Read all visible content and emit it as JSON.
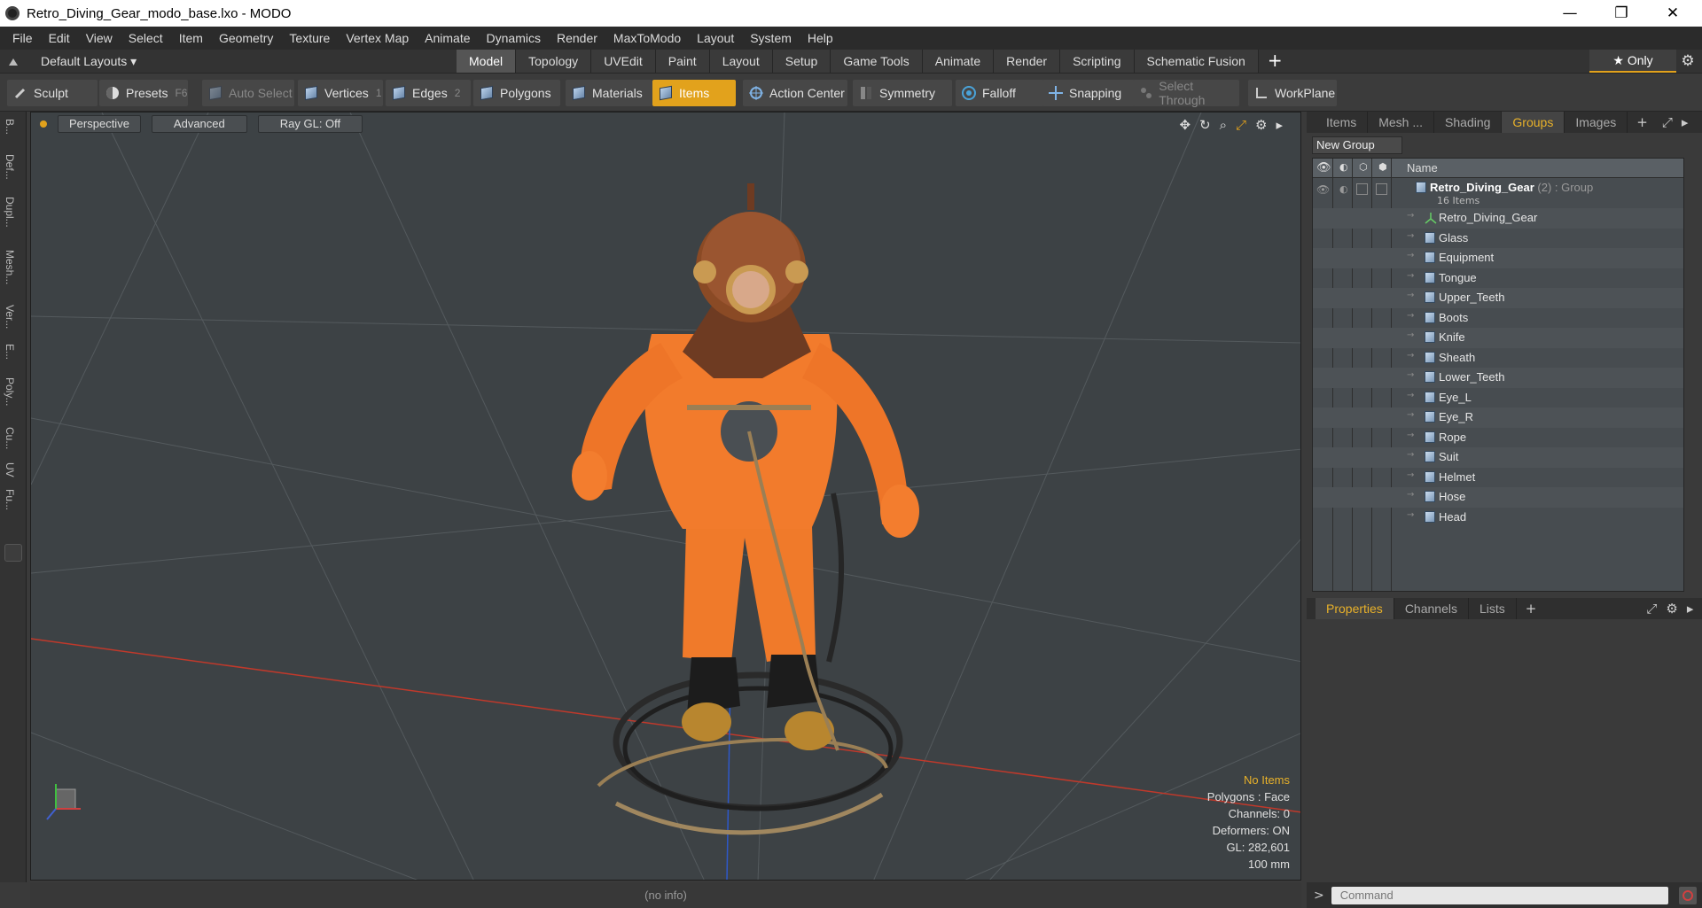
{
  "window": {
    "title": "Retro_Diving_Gear_modo_base.lxo - MODO",
    "minimize": "—",
    "maximize": "❐",
    "close": "✕"
  },
  "menu": [
    "File",
    "Edit",
    "View",
    "Select",
    "Item",
    "Geometry",
    "Texture",
    "Vertex Map",
    "Animate",
    "Dynamics",
    "Render",
    "MaxToModo",
    "Layout",
    "System",
    "Help"
  ],
  "layoutbar": {
    "layouts": "Default Layouts ▾",
    "tabs": [
      "Model",
      "Topology",
      "UVEdit",
      "Paint",
      "Layout",
      "Setup",
      "Game Tools",
      "Animate",
      "Render",
      "Scripting",
      "Schematic Fusion"
    ],
    "active_tab": "Model",
    "add": "+",
    "only": "★  Only"
  },
  "toolbar": {
    "sculpt": "Sculpt",
    "presets": "Presets",
    "presets_hotkey": "F6",
    "auto_select": "Auto Select",
    "vertices": "Vertices",
    "vertices_count": "1",
    "edges": "Edges",
    "edges_count": "2",
    "polygons": "Polygons",
    "materials": "Materials",
    "items": "Items",
    "action_center": "Action Center",
    "symmetry": "Symmetry",
    "falloff": "Falloff",
    "snapping": "Snapping",
    "select_through": "Select Through",
    "workplane": "WorkPlane"
  },
  "left_strip": [
    "B...",
    "Def...",
    "Dupl...",
    "Mesh...",
    "Ver...",
    "E...",
    "Poly...",
    "Cu...",
    "UV",
    "Fu..."
  ],
  "viewport": {
    "view": "Perspective",
    "advanced": "Advanced",
    "raygl": "Ray GL: Off",
    "info": {
      "selection": "No Items",
      "polygons": "Polygons : Face",
      "channels": "Channels: 0",
      "deformers": "Deformers: ON",
      "gl": "GL: 282,601",
      "unit": "100 mm"
    }
  },
  "status": {
    "info": "(no info)"
  },
  "items_panel": {
    "tabs": [
      "Items",
      "Mesh ...",
      "Shading",
      "Groups",
      "Images"
    ],
    "active_tab": "Groups",
    "add": "+",
    "new_group": "New Group",
    "col_name": "Name",
    "group": {
      "name": "Retro_Diving_Gear",
      "suffix": "(2) : Group",
      "count": "16 Items"
    },
    "items": [
      "Retro_Diving_Gear",
      "Glass",
      "Equipment",
      "Tongue",
      "Upper_Teeth",
      "Boots",
      "Knife",
      "Sheath",
      "Lower_Teeth",
      "Eye_L",
      "Eye_R",
      "Rope",
      "Suit",
      "Helmet",
      "Hose",
      "Head"
    ]
  },
  "properties_panel": {
    "tabs": [
      "Properties",
      "Channels",
      "Lists"
    ],
    "active_tab": "Properties",
    "add": "+"
  },
  "command": {
    "prompt": ">",
    "placeholder": "Command"
  },
  "colors": {
    "accent": "#e2a21c",
    "suit_orange": "#f07a2a",
    "helmet_copper": "#8a4a25"
  }
}
